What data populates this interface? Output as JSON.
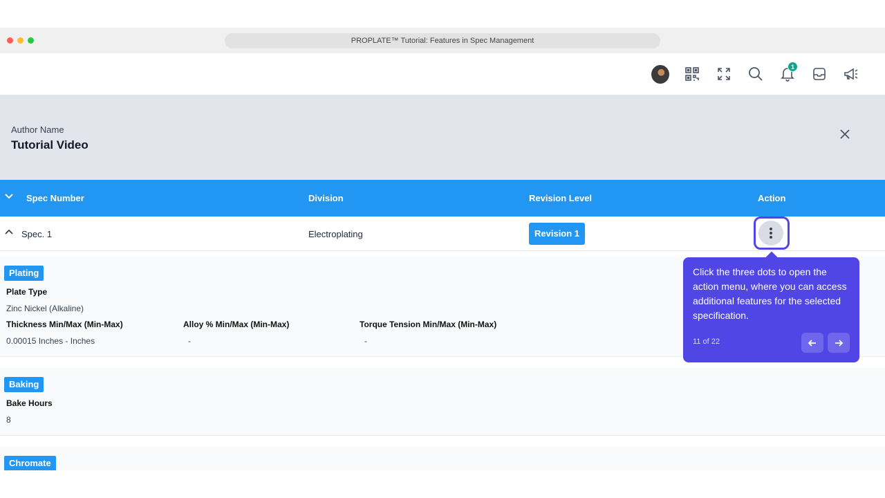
{
  "browser": {
    "title": "PROPLATE™ Tutorial: Features in Spec Management"
  },
  "appbar": {
    "icons": [
      "avatar",
      "qr-code-icon",
      "fullscreen-icon",
      "search-icon",
      "bell-icon",
      "inbox-icon",
      "megaphone-icon"
    ],
    "notification_count": "1"
  },
  "header": {
    "author_label": "Author Name",
    "author_name": "Tutorial Video"
  },
  "table": {
    "columns": {
      "spec_number": "Spec Number",
      "division": "Division",
      "revision_level": "Revision Level",
      "action": "Action"
    },
    "row": {
      "spec": "Spec. 1",
      "division": "Electroplating",
      "revision": "Revision 1"
    }
  },
  "sections": {
    "plating": {
      "tag": "Plating",
      "plate_type_label": "Plate Type",
      "plate_type_value": "Zinc Nickel (Alkaline)",
      "thickness_label": "Thickness Min/Max (Min-Max)",
      "thickness_value": "0.00015 Inches -  Inches",
      "alloy_label": "Alloy % Min/Max (Min-Max)",
      "alloy_value": "-",
      "torque_label": "Torque Tension Min/Max (Min-Max)",
      "torque_value": "-"
    },
    "baking": {
      "tag": "Baking",
      "bake_hours_label": "Bake Hours",
      "bake_hours_value": "8"
    },
    "chromate": {
      "tag": "Chromate"
    }
  },
  "tooltip": {
    "text": "Click the three dots to open the action menu, where you can access additional features for the selected specification.",
    "counter": "11 of 22"
  },
  "colors": {
    "primary": "#2196f3",
    "tooltip": "#4f46e5",
    "badge": "#14a38b"
  }
}
